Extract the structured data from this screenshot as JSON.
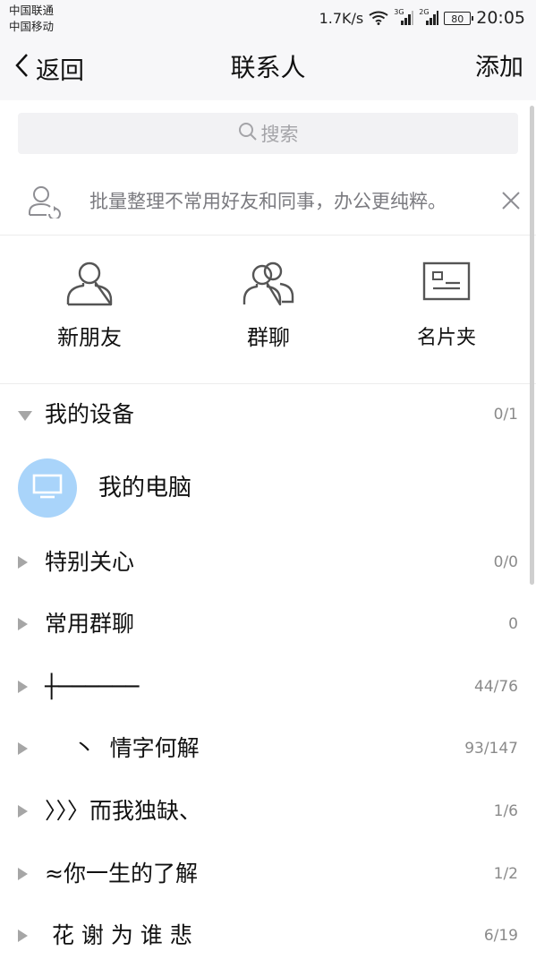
{
  "status_bar": {
    "carrier_1": "中国联通",
    "carrier_2": "中国移动",
    "speed": "1.7K/s",
    "net_3g": "3G",
    "net_2g": "2G",
    "battery": "80",
    "time": "20:05"
  },
  "nav": {
    "back_label": "返回",
    "title": "联系人",
    "add_label": "添加"
  },
  "search": {
    "placeholder": "搜索"
  },
  "tip": {
    "text": "批量整理不常用好友和同事，办公更纯粹。"
  },
  "quick_actions": [
    {
      "label": "新朋友",
      "icon": "person-icon"
    },
    {
      "label": "群聊",
      "icon": "group-icon"
    },
    {
      "label": "名片夹",
      "icon": "card-icon"
    }
  ],
  "groups": [
    {
      "name": "我的设备",
      "count": "0/1",
      "expanded": true
    },
    {
      "name": "特别关心",
      "count": "0/0",
      "expanded": false
    },
    {
      "name": "常用群聊",
      "count": "0",
      "expanded": false
    },
    {
      "name": "┼──────",
      "count": "44/76",
      "expanded": false
    },
    {
      "name": "    丶  情字何解",
      "count": "93/147",
      "expanded": false
    },
    {
      "name": "〉〉〉而我独缺、",
      "count": "1/6",
      "expanded": false
    },
    {
      "name": "≈你一生的了解",
      "count": "1/2",
      "expanded": false
    },
    {
      "name": " 花 谢 为 谁 悲",
      "count": "6/19",
      "expanded": false
    }
  ],
  "device": {
    "name": "我的电脑"
  },
  "colors": {
    "bar_bg": "#f7f7f9",
    "device_avatar": "#a9d4fa",
    "muted_text": "#8a8a8a"
  }
}
